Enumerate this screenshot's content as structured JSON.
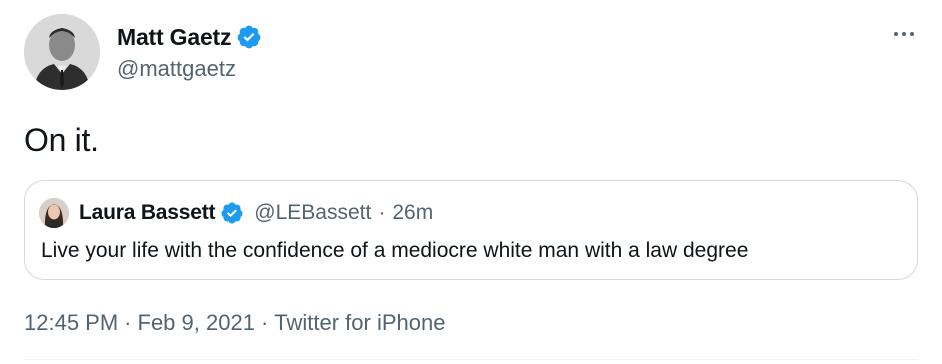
{
  "tweet": {
    "author": {
      "name": "Matt Gaetz",
      "handle": "@mattgaetz",
      "verified_icon": "verified-badge"
    },
    "more_icon": "more-horizontal-icon",
    "text": "On it.",
    "quote": {
      "author_name": "Laura Bassett",
      "author_handle": "@LEBassett",
      "dot": "·",
      "relative_time": "26m",
      "text": "Live your life with the confidence of a mediocre white man with a law degree"
    },
    "meta": {
      "time": "12:45 PM",
      "sep1": "·",
      "date": "Feb 9, 2021",
      "sep2": "·",
      "source": "Twitter for iPhone"
    }
  },
  "colors": {
    "verified": "#1d9bf0",
    "secondary_text": "#536471",
    "primary_text": "#0f1419",
    "border": "#cfd9de"
  }
}
